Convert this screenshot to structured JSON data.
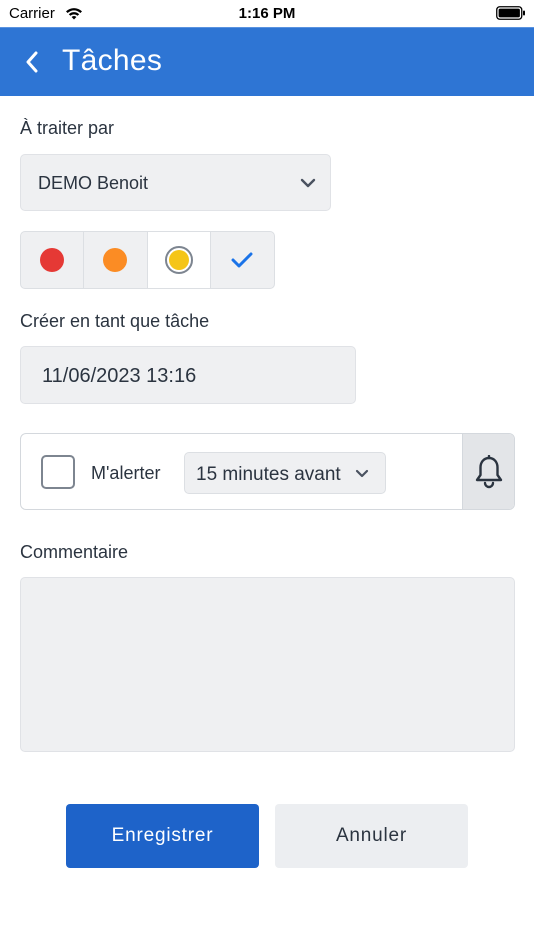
{
  "status_bar": {
    "carrier": "Carrier",
    "time": "1:16 PM"
  },
  "nav": {
    "title": "Tâches",
    "back_icon": "chevron-left-icon"
  },
  "form": {
    "assignee_label": "À traiter par",
    "assignee_value": "DEMO Benoit",
    "priority": {
      "options": [
        {
          "name": "red",
          "color": "#e53935"
        },
        {
          "name": "orange",
          "color": "#fb8c24"
        },
        {
          "name": "yellow",
          "color": "#f5c518"
        },
        {
          "name": "done",
          "color": "#1a73e8",
          "icon": "check-icon"
        }
      ],
      "selected": "yellow"
    },
    "create_label": "Créer en tant que tâche",
    "date_value": "11/06/2023 13:16",
    "alert": {
      "label": "M'alerter",
      "checked": false,
      "delay_value": "15 minutes avant",
      "bell_icon": "bell-icon"
    },
    "comment_label": "Commentaire",
    "comment_value": ""
  },
  "actions": {
    "save_label": "Enregistrer",
    "cancel_label": "Annuler"
  },
  "colors": {
    "accent": "#2e75d4",
    "primary_button": "#1e63c9"
  }
}
